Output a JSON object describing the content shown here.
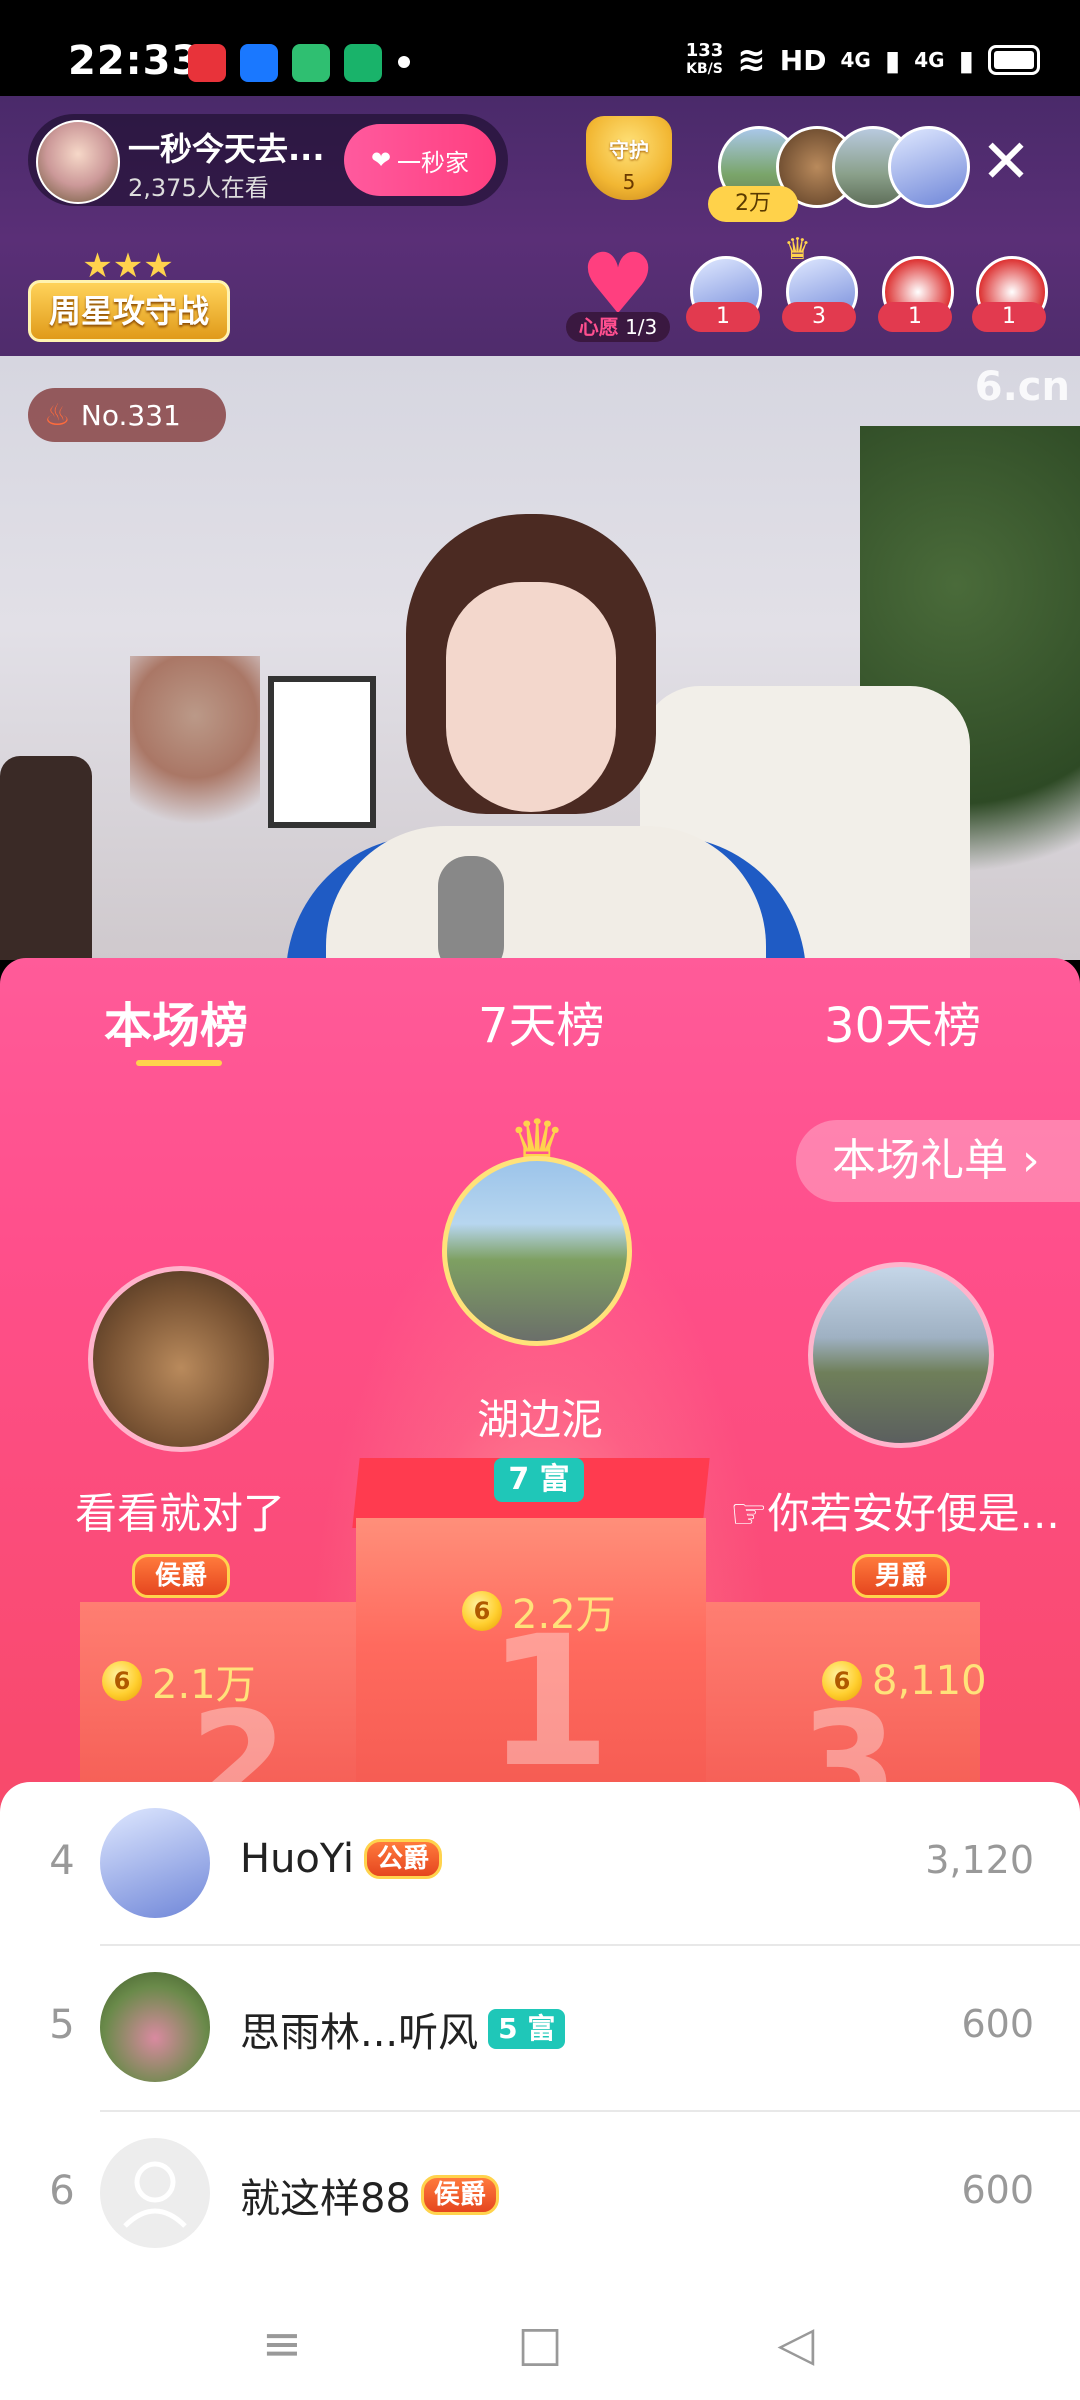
{
  "status_bar": {
    "time": "22:33",
    "net_speed_value": "133",
    "net_speed_unit": "KB/S",
    "network_labels": [
      "HD",
      "4G",
      "4G"
    ]
  },
  "header": {
    "anchor_name": "一秒今天去...",
    "viewers": "2,375人在看",
    "follow_button": "一秒家",
    "guard_label": "守护",
    "guard_count": "5",
    "top_coin": "2万",
    "weekly_badge": "周星攻守战",
    "wish_label": "心愿",
    "wish_progress": "1/3",
    "gift_counts": [
      "1",
      "3",
      "1",
      "1"
    ]
  },
  "video": {
    "rank_badge": "No.331",
    "watermark": "6.cn"
  },
  "panel": {
    "tabs": [
      "本场榜",
      "7天榜",
      "30天榜"
    ],
    "gift_list_button": "本场礼单 ›",
    "first": {
      "name": "湖边泥",
      "rich_level": "7 富",
      "score": "2.2万",
      "podium_number": "1"
    },
    "second": {
      "name": "看看就对了",
      "noble": "侯爵",
      "score": "2.1万",
      "podium_number": "2"
    },
    "third": {
      "name": "☞你若安好便是...",
      "noble": "男爵",
      "score": "8,110",
      "podium_number": "3"
    }
  },
  "list": {
    "rows": [
      {
        "rank": "4",
        "name": "HuoYi",
        "tag": "公爵",
        "tag_type": "noble",
        "score": "3,120"
      },
      {
        "rank": "5",
        "name": "思雨林...听风",
        "tag": "5 富",
        "tag_type": "rich",
        "score": "600"
      },
      {
        "rank": "6",
        "name": "就这样88",
        "tag": "侯爵",
        "tag_type": "noble",
        "score": "600"
      }
    ]
  },
  "colors": {
    "panel_pink": "#ff4f8b",
    "gold": "#ffd34d",
    "rich_teal": "#1fc7b8",
    "header_purple": "#5a2f77"
  },
  "icons": {
    "close": "close-icon",
    "heart": "heart-icon",
    "coin": "coin-icon",
    "crown": "crown-icon",
    "fire": "fire-icon",
    "nav": [
      "menu-icon",
      "home-square-icon",
      "back-triangle-icon"
    ]
  }
}
